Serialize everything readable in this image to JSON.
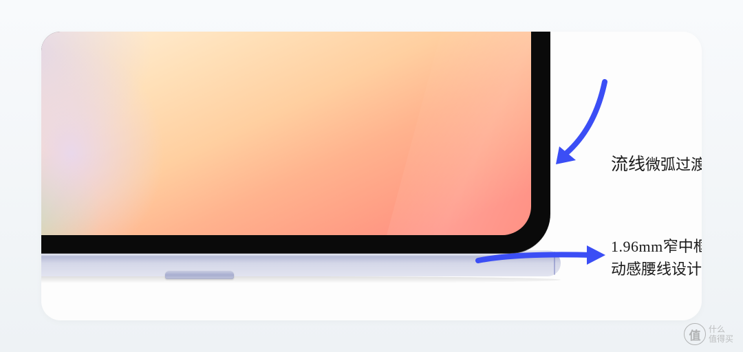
{
  "annotations": {
    "top": {
      "line1_large": "流线",
      "line1_rest": "微弧过渡"
    },
    "bottom": {
      "measurement": "1.96mm",
      "line1_rest": "窄中框",
      "line2": "动感腰线设计"
    }
  },
  "watermark": {
    "icon_text": "值",
    "line1": "什么",
    "line2": "值得买"
  },
  "colors": {
    "arrow": "#3b4ef5"
  }
}
